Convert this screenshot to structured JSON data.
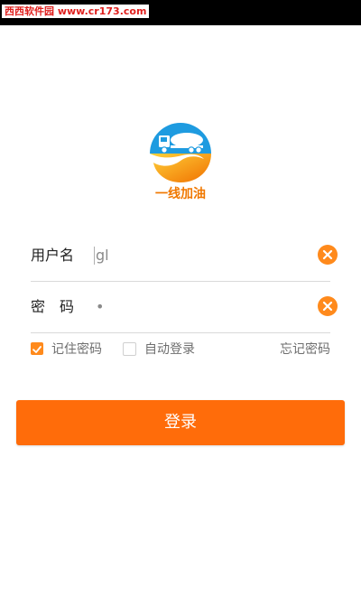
{
  "watermark": "西西软件园 www.cr173.com",
  "logo": {
    "icon": "oil-tanker-truck-logo",
    "text": "一线加油"
  },
  "form": {
    "username_label": "用户名",
    "username_value": "gl",
    "password_label": "密　码",
    "password_value": "•",
    "clear_icon": "clear-x-icon"
  },
  "options": {
    "remember_password": {
      "label": "记住密码",
      "checked": true
    },
    "auto_login": {
      "label": "自动登录",
      "checked": false
    },
    "forgot_password": "忘记密码"
  },
  "login_button": "登录",
  "colors": {
    "accent": "#ff6c0a",
    "accent_light": "#ff8a1c",
    "logo_blue": "#1e9be0",
    "logo_orange": "#f07800"
  }
}
